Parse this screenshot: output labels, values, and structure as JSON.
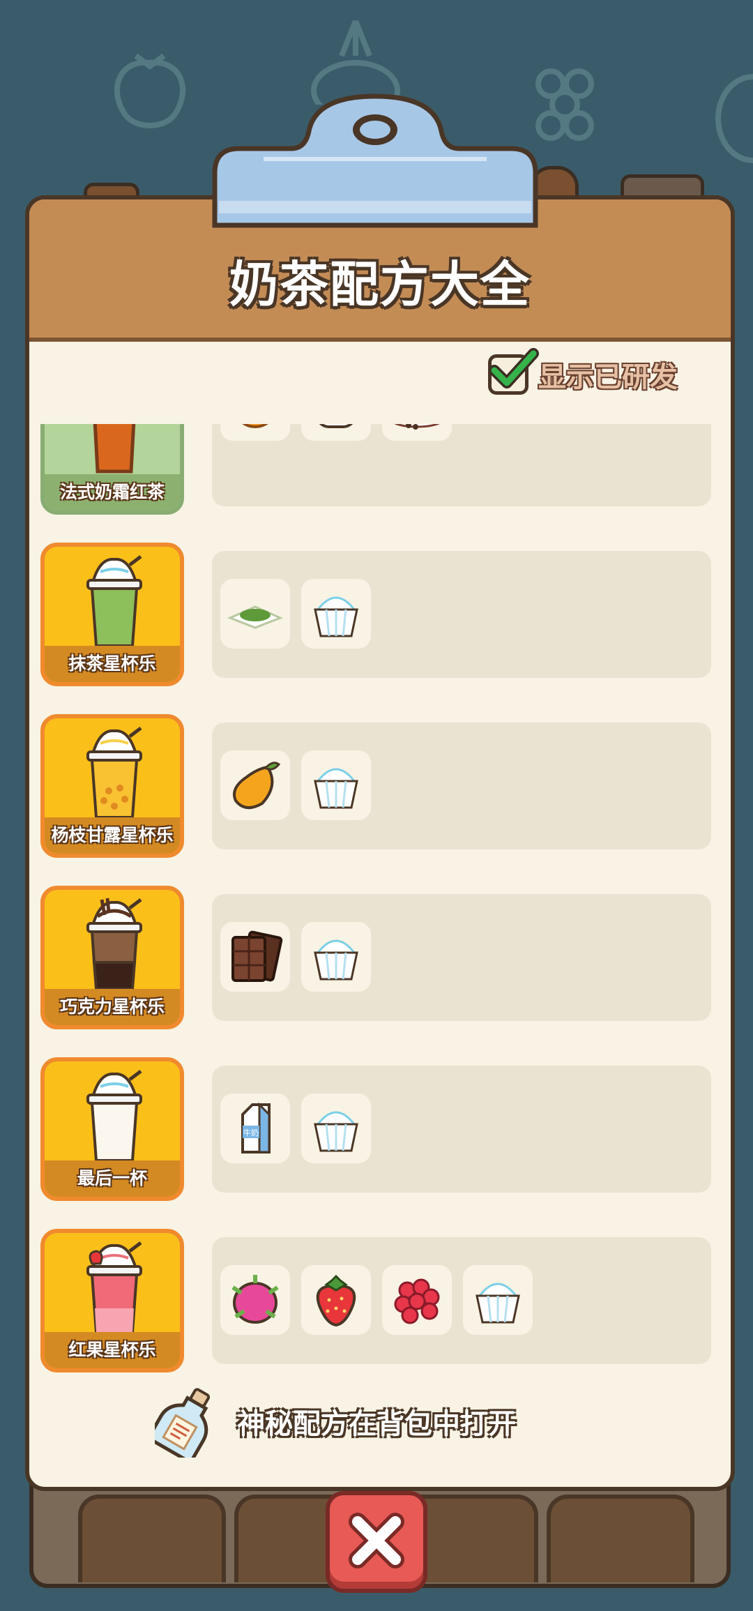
{
  "panel": {
    "title": "奶茶配方大全",
    "show_researched_label": "显示已研发",
    "show_researched_checked": true,
    "footer_note": "神秘配方在背包中打开"
  },
  "recipes": [
    {
      "name": "法式奶霜红茶",
      "status": "researched",
      "ingredients": [
        "orange-icon",
        "milk-jar-icon",
        "black-tea-cup-icon"
      ]
    },
    {
      "name": "抹茶星杯乐",
      "ingredients": [
        "matcha-powder-icon",
        "ice-cream-icon"
      ]
    },
    {
      "name": "杨枝甘露星杯乐",
      "ingredients": [
        "mango-icon",
        "ice-cream-icon"
      ]
    },
    {
      "name": "巧克力星杯乐",
      "ingredients": [
        "chocolate-bar-icon",
        "ice-cream-icon"
      ]
    },
    {
      "name": "最后一杯",
      "ingredients": [
        "milk-carton-icon",
        "ice-cream-icon"
      ]
    },
    {
      "name": "红果星杯乐",
      "ingredients": [
        "dragon-fruit-icon",
        "strawberry-icon",
        "raspberry-icon",
        "ice-cream-icon"
      ]
    }
  ],
  "milk_carton_label": "牛奶",
  "colors": {
    "background": "#3a5c6a",
    "board": "#f8f3e4",
    "header": "#c48c55",
    "card_locked": "#fbbf1a",
    "card_researched": "#b3d49a",
    "close_button": "#e85a56"
  }
}
